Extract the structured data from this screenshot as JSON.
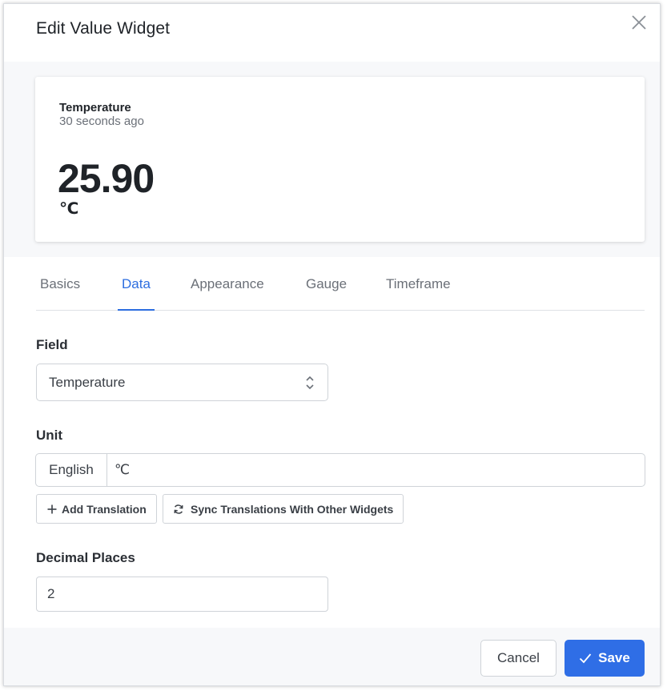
{
  "dialog": {
    "title": "Edit Value Widget"
  },
  "preview": {
    "label": "Temperature",
    "time": "30 seconds ago",
    "value": "25.90",
    "unit": "℃"
  },
  "tabs": [
    {
      "label": "Basics",
      "active": false
    },
    {
      "label": "Data",
      "active": true
    },
    {
      "label": "Appearance",
      "active": false
    },
    {
      "label": "Gauge",
      "active": false
    },
    {
      "label": "Timeframe",
      "active": false
    }
  ],
  "form": {
    "field_label": "Field",
    "field_value": "Temperature",
    "unit_label": "Unit",
    "unit_language": "English",
    "unit_value": "℃",
    "add_translation": "Add Translation",
    "sync_translations": "Sync Translations With Other Widgets",
    "decimal_label": "Decimal Places",
    "decimal_value": "2"
  },
  "footer": {
    "cancel": "Cancel",
    "save": "Save"
  },
  "colors": {
    "accent": "#2f6ee6",
    "active_tab": "#2d6ee0",
    "text": "#1f2328",
    "muted": "#6b7078"
  }
}
